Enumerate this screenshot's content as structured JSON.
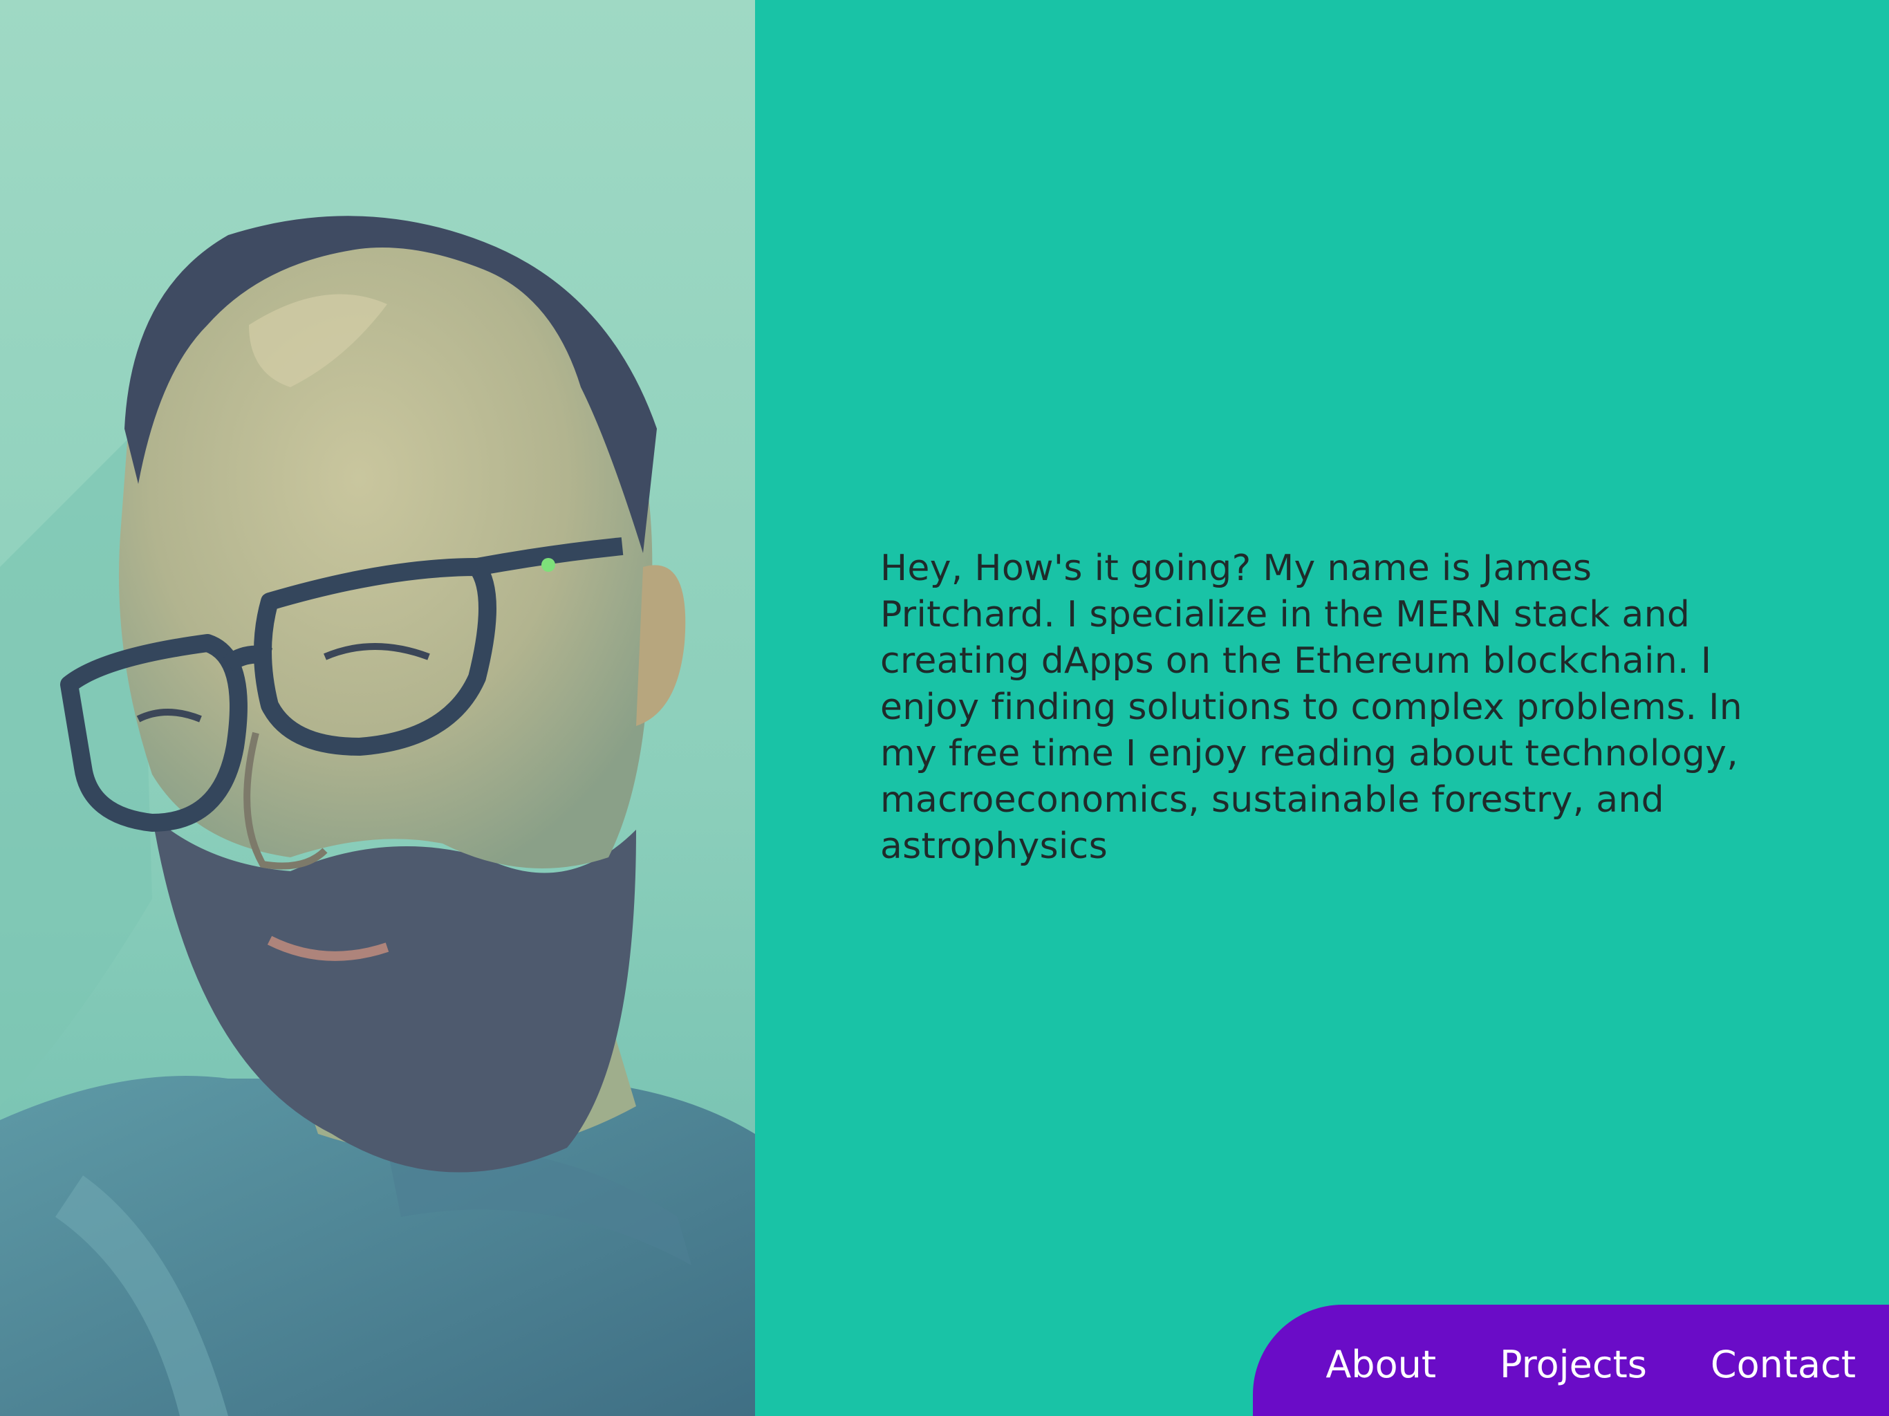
{
  "profile": {
    "bio": "Hey, How's it going? My name is James Pritchard. I specialize in the MERN stack and creating dApps on the Ethereum blockchain. I enjoy finding solutions to complex problems. In my free time I enjoy reading about technology, macroeconomics, sustainable forestry, and astrophysics"
  },
  "nav": {
    "items": [
      {
        "label": "About"
      },
      {
        "label": "Projects"
      },
      {
        "label": "Contact"
      }
    ]
  },
  "colors": {
    "background": "#19c3a6",
    "portrait_background": "#9dd9c3",
    "nav_background": "#6a0cc7",
    "nav_text": "#ffffff",
    "body_text": "#1f2a2a"
  }
}
